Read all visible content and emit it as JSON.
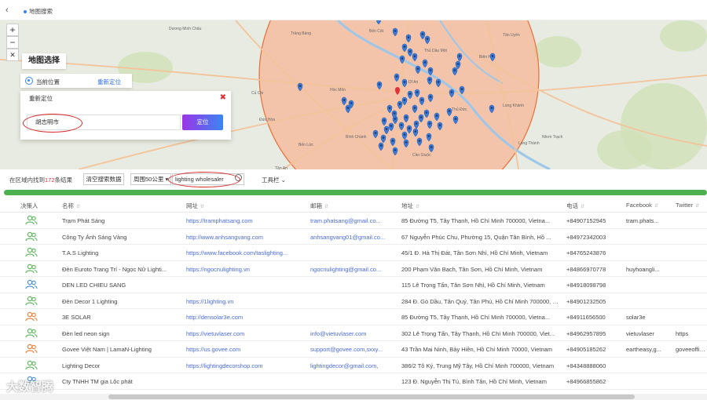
{
  "topbar": {
    "tab_label": "地图搜索"
  },
  "map": {
    "panel_title": "地图选择",
    "current_location_label": "当前位置",
    "relocate_link": "重新定位",
    "dialog_title": "重新定位",
    "city_value": "胡志明市",
    "locate_button": "定位",
    "labels": [
      "Trảng Bàng",
      "Dương Minh Châu",
      "Tân Uyên",
      "Bến Cát",
      "Thủ Dầu Một",
      "Biên Hòa",
      "Dĩ An",
      "Long Khánh",
      "Thủ Đức",
      "Nhơn Trạch",
      "Long Thành",
      "Cần Giuộc",
      "Bến Lức",
      "Đức Hòa",
      "Củ Chi",
      "Hóc Môn",
      "Bình Chánh",
      "Tân An"
    ]
  },
  "status": {
    "result_prefix": "在区域内找到",
    "result_count": "172",
    "result_suffix": "条结果",
    "clear_button": "清空搜索数据",
    "range_select": "周围50公里",
    "keyword_value": "lighting wholesaler",
    "toolbar_menu": "工具栏"
  },
  "progress": 1.0,
  "table": {
    "columns": [
      "决策人",
      "名称",
      "网址",
      "邮箱",
      "地址",
      "电话",
      "Facebook",
      "Twitter"
    ],
    "rows": [
      {
        "person": "green",
        "name": "Trạm Phát Sáng",
        "url": "https://tramphatsang.com",
        "email": "tram.phatsang@gmail.co...",
        "address": "85 Đường T5, Tây Thạnh, Hồ Chí Minh 700000, Vietna...",
        "phone": "+84907152945",
        "facebook": "tram.phats...",
        "twitter": ""
      },
      {
        "person": "green",
        "name": "Công Ty Ánh Sáng Vàng",
        "url": "http://www.anhsangvang.com",
        "email": "anhsangvang01@gmail.co...",
        "address": "67 Nguyễn Phúc Chu, Phường 15, Quận Tân Bình, Hồ ...",
        "phone": "+84972342003",
        "facebook": "",
        "twitter": ""
      },
      {
        "person": "green",
        "name": "T.A.S Lighting",
        "url": "https://www.facebook.com/taslighting...",
        "email": "",
        "address": "45/1 Đ. Hà Thị Đát, Tân Sơn Nhì, Hồ Chí Minh, Vietnam",
        "phone": "+84765243876",
        "facebook": "",
        "twitter": ""
      },
      {
        "person": "green",
        "name": "Đèn Euroto Trang Trí - Ngọc Nữ Lighti...",
        "url": "https://ngocnulighting.vn",
        "email": "ngocnulighting@gmail.co...",
        "address": "200 Phạm Văn Bạch, Tân Sơn, Hồ Chí Minh, Vietnam",
        "phone": "+84866970778",
        "facebook": "huyhoangli...",
        "twitter": ""
      },
      {
        "person": "blue",
        "name": "DEN LED CHIEU SANG",
        "url": "",
        "email": "",
        "address": "115 Lê Trọng Tấn, Tân Sơn Nhì, Hồ Chí Minh, Vietnam",
        "phone": "+84918098798",
        "facebook": "",
        "twitter": ""
      },
      {
        "person": "green",
        "name": "Đèn Decor 1 Lighting",
        "url": "https://1lighting.vn",
        "email": "",
        "address": "284 Đ. Gò Dầu, Tân Quý, Tân Phú, Hồ Chí Minh 700000, Vi...",
        "phone": "+84901232505",
        "facebook": "",
        "twitter": ""
      },
      {
        "person": "orange",
        "name": "3E SOLAR",
        "url": "http://densolar3e.com",
        "email": "",
        "address": "85 Đường T5, Tây Thạnh, Hồ Chí Minh 700000, Vietna...",
        "phone": "+84911656500",
        "facebook": "solar3e",
        "twitter": ""
      },
      {
        "person": "green",
        "name": "Đèn led neon sign",
        "url": "https://vietuvlaser.com",
        "email": "info@vietuvlaser.com",
        "address": "302 Lê Trọng Tấn, Tây Thạnh, Hồ Chí Minh 700000, Viet...",
        "phone": "+84962957895",
        "facebook": "vietuvlaser",
        "twitter": "https"
      },
      {
        "person": "orange",
        "name": "Govee Việt Nam | LamaN-Lighting",
        "url": "https://us.govee.com",
        "email": "support@govee.com,sxxy...",
        "address": "43 Trần Mai Ninh, Bảy Hiền, Hồ Chí Minh 70000, Vietnam",
        "phone": "+84905185262",
        "facebook": "eartheasy,g...",
        "twitter": "goveeoffici..."
      },
      {
        "person": "green",
        "name": "Lighting Decor",
        "url": "https://lightingdecorshop.com",
        "email": "lightingdecor@gmail.com,",
        "address": "386/2 Tô Ký, Trung Mỹ Tây, Hồ Chí Minh 700000, Vietnam",
        "phone": "+84348888060",
        "facebook": "",
        "twitter": ""
      },
      {
        "person": "blue",
        "name": "Cty TNHH TM gia Lộc phát",
        "url": "",
        "email": "",
        "address": "123 Đ. Nguyễn Thị Tú, Bình Tân, Hồ Chí Minh, Vietnam",
        "phone": "+84966855862",
        "facebook": "",
        "twitter": ""
      }
    ]
  },
  "watermark": "大数智腾",
  "colors": {
    "accent": "#3a86f2",
    "highlight_red": "#d62828",
    "progress": "#4caf50",
    "pin": "#3b7bd8",
    "radius_fill": "#f6b493"
  }
}
